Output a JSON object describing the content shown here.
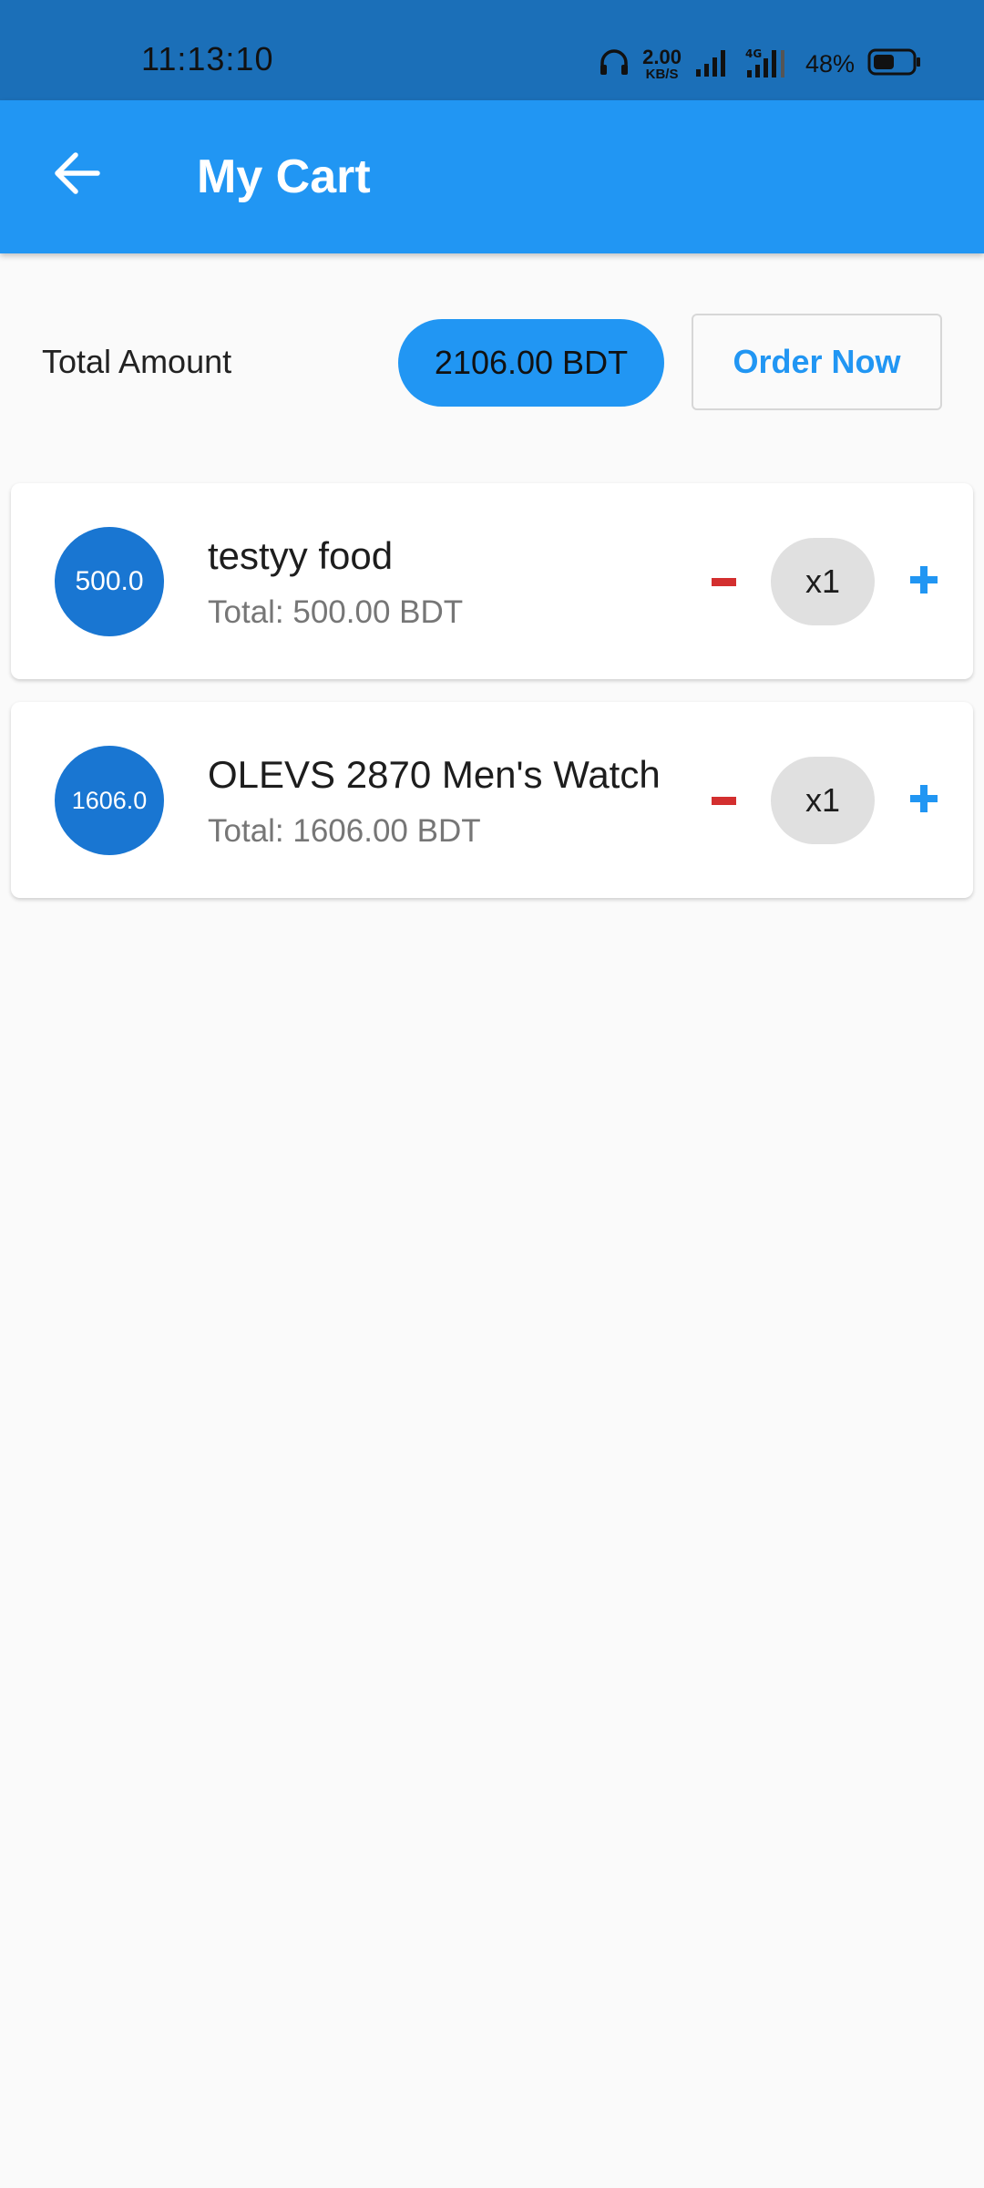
{
  "status_bar": {
    "time": "11:13:10",
    "net_speed_value": "2.00",
    "net_speed_unit": "KB/S",
    "network_type": "4G",
    "battery_percent": "48%",
    "icons": [
      "headphones-icon",
      "signal-icon",
      "signal-4g-icon",
      "battery-icon"
    ]
  },
  "app_bar": {
    "title": "My Cart",
    "back_icon": "arrow-left-icon",
    "background": "#2196f3"
  },
  "summary": {
    "total_label": "Total Amount",
    "total_value": "2106.00 BDT",
    "order_button": "Order Now"
  },
  "cart_items": [
    {
      "price": "500.0",
      "name": "testyy food",
      "total": "Total: 500.00 BDT",
      "quantity": "x1"
    },
    {
      "price": "1606.0",
      "name": "OLEVS 2870 Men's Watch",
      "total": "Total: 1606.00 BDT",
      "quantity": "x1"
    }
  ],
  "colors": {
    "accent": "#2196f3",
    "status_bar": "#1b6fb8",
    "price_circle": "#1976d2",
    "remove": "#d32f2f",
    "quantity_chip": "#e0e0e0"
  }
}
